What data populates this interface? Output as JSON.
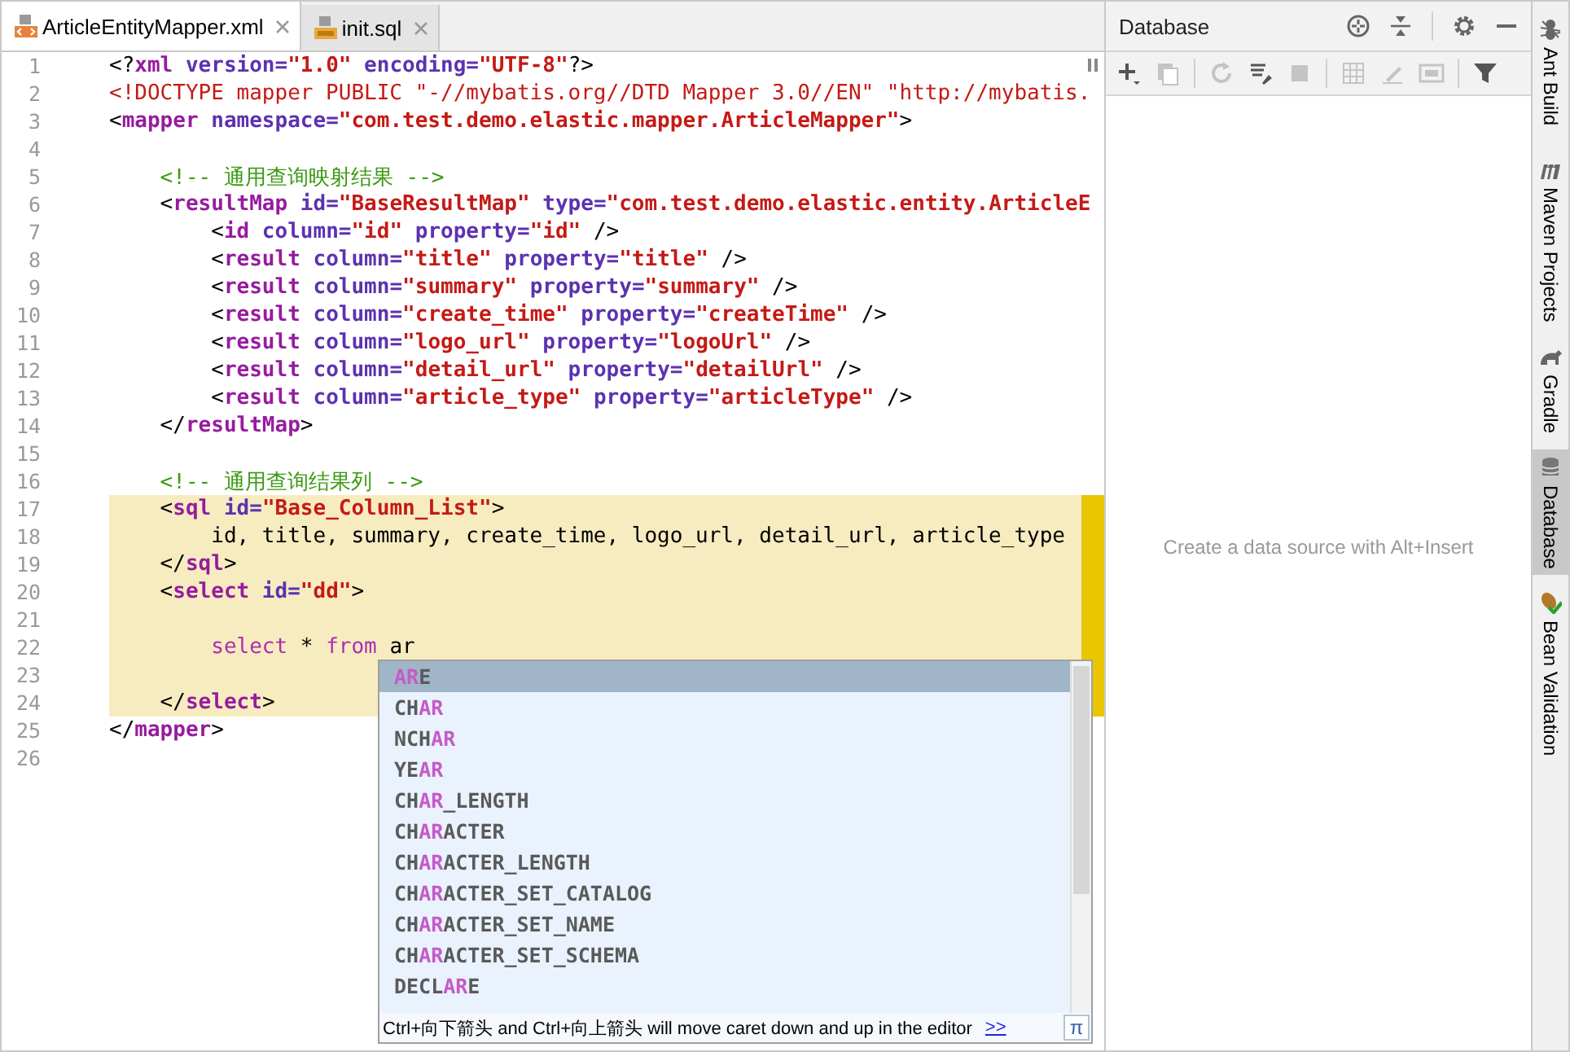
{
  "editor_tabs": [
    {
      "label": "ArticleEntityMapper.xml",
      "kind": "xml",
      "selected": true
    },
    {
      "label": "init.sql",
      "kind": "sql",
      "selected": false
    }
  ],
  "lines": [
    {
      "number": "1",
      "tokens": [
        {
          "kind": "punct",
          "text": "<?"
        },
        {
          "kind": "tag",
          "text": "xml"
        },
        {
          "kind": "attr",
          "text": " version="
        },
        {
          "kind": "value",
          "text": "\"1.0\""
        },
        {
          "kind": "attr",
          "text": " encoding="
        },
        {
          "kind": "value",
          "text": "\"UTF-8\""
        },
        {
          "kind": "punct",
          "text": "?>"
        }
      ]
    },
    {
      "number": "2",
      "tokens": [
        {
          "kind": "doctype",
          "text": "<!DOCTYPE mapper PUBLIC \"-//mybatis.org//DTD Mapper 3.0//EN\" \"http://mybatis."
        }
      ]
    },
    {
      "number": "3",
      "tokens": [
        {
          "kind": "punct",
          "text": "<"
        },
        {
          "kind": "tag",
          "text": "mapper"
        },
        {
          "kind": "attr",
          "text": " namespace="
        },
        {
          "kind": "value",
          "text": "\"com.test.demo.elastic.mapper.ArticleMapper\""
        },
        {
          "kind": "punct",
          "text": ">"
        }
      ]
    },
    {
      "number": "4"
    },
    {
      "number": "5",
      "tokens": [
        {
          "kind": "comment",
          "text": "    <!-- 通用查询映射结果 -->"
        }
      ]
    },
    {
      "number": "6",
      "tokens": [
        {
          "kind": "punct",
          "text": "    <"
        },
        {
          "kind": "tag",
          "text": "resultMap"
        },
        {
          "kind": "attr",
          "text": " id="
        },
        {
          "kind": "value",
          "text": "\"BaseResultMap\""
        },
        {
          "kind": "attr",
          "text": " type="
        },
        {
          "kind": "value",
          "text": "\"com.test.demo.elastic.entity.ArticleE"
        }
      ]
    },
    {
      "number": "7",
      "tokens": [
        {
          "kind": "punct",
          "text": "        <"
        },
        {
          "kind": "tag",
          "text": "id"
        },
        {
          "kind": "attr",
          "text": " column="
        },
        {
          "kind": "value",
          "text": "\"id\""
        },
        {
          "kind": "attr",
          "text": " property="
        },
        {
          "kind": "value",
          "text": "\"id\""
        },
        {
          "kind": "punct",
          "text": " />"
        }
      ]
    },
    {
      "number": "8",
      "tokens": [
        {
          "kind": "punct",
          "text": "        <"
        },
        {
          "kind": "tag",
          "text": "result"
        },
        {
          "kind": "attr",
          "text": " column="
        },
        {
          "kind": "value",
          "text": "\"title\""
        },
        {
          "kind": "attr",
          "text": " property="
        },
        {
          "kind": "value",
          "text": "\"title\""
        },
        {
          "kind": "punct",
          "text": " />"
        }
      ]
    },
    {
      "number": "9",
      "tokens": [
        {
          "kind": "punct",
          "text": "        <"
        },
        {
          "kind": "tag",
          "text": "result"
        },
        {
          "kind": "attr",
          "text": " column="
        },
        {
          "kind": "value",
          "text": "\"summary\""
        },
        {
          "kind": "attr",
          "text": " property="
        },
        {
          "kind": "value",
          "text": "\"summary\""
        },
        {
          "kind": "punct",
          "text": " />"
        }
      ]
    },
    {
      "number": "10",
      "tokens": [
        {
          "kind": "punct",
          "text": "        <"
        },
        {
          "kind": "tag",
          "text": "result"
        },
        {
          "kind": "attr",
          "text": " column="
        },
        {
          "kind": "value",
          "text": "\"create_time\""
        },
        {
          "kind": "attr",
          "text": " property="
        },
        {
          "kind": "value",
          "text": "\"createTime\""
        },
        {
          "kind": "punct",
          "text": " />"
        }
      ]
    },
    {
      "number": "11",
      "tokens": [
        {
          "kind": "punct",
          "text": "        <"
        },
        {
          "kind": "tag",
          "text": "result"
        },
        {
          "kind": "attr",
          "text": " column="
        },
        {
          "kind": "value",
          "text": "\"logo_url\""
        },
        {
          "kind": "attr",
          "text": " property="
        },
        {
          "kind": "value",
          "text": "\"logoUrl\""
        },
        {
          "kind": "punct",
          "text": " />"
        }
      ]
    },
    {
      "number": "12",
      "tokens": [
        {
          "kind": "punct",
          "text": "        <"
        },
        {
          "kind": "tag",
          "text": "result"
        },
        {
          "kind": "attr",
          "text": " column="
        },
        {
          "kind": "value",
          "text": "\"detail_url\""
        },
        {
          "kind": "attr",
          "text": " property="
        },
        {
          "kind": "value",
          "text": "\"detailUrl\""
        },
        {
          "kind": "punct",
          "text": " />"
        }
      ]
    },
    {
      "number": "13",
      "tokens": [
        {
          "kind": "punct",
          "text": "        <"
        },
        {
          "kind": "tag",
          "text": "result"
        },
        {
          "kind": "attr",
          "text": " column="
        },
        {
          "kind": "value",
          "text": "\"article_type\""
        },
        {
          "kind": "attr",
          "text": " property="
        },
        {
          "kind": "value",
          "text": "\"articleType\""
        },
        {
          "kind": "punct",
          "text": " />"
        }
      ]
    },
    {
      "number": "14",
      "tokens": [
        {
          "kind": "punct",
          "text": "    </"
        },
        {
          "kind": "tag",
          "text": "resultMap"
        },
        {
          "kind": "punct",
          "text": ">"
        }
      ]
    },
    {
      "number": "15"
    },
    {
      "number": "16",
      "tokens": [
        {
          "kind": "comment",
          "text": "    <!-- 通用查询结果列 -->"
        }
      ]
    },
    {
      "number": "17",
      "injected": true,
      "tokens": [
        {
          "kind": "punct",
          "text": "    <"
        },
        {
          "kind": "tag",
          "text": "sql"
        },
        {
          "kind": "attr",
          "text": " id="
        },
        {
          "kind": "value",
          "text": "\"Base_Column_List\""
        },
        {
          "kind": "punct",
          "text": ">"
        }
      ]
    },
    {
      "number": "18",
      "injected": true,
      "tokens": [
        {
          "kind": "text",
          "text": "        id, title, summary, create_time, logo_url, detail_url, article_type"
        }
      ]
    },
    {
      "number": "19",
      "injected": true,
      "tokens": [
        {
          "kind": "punct",
          "text": "    </"
        },
        {
          "kind": "tag",
          "text": "sql"
        },
        {
          "kind": "punct",
          "text": ">"
        }
      ]
    },
    {
      "number": "20",
      "injected": true,
      "tokens": [
        {
          "kind": "punct",
          "text": "    <"
        },
        {
          "kind": "tag",
          "text": "select"
        },
        {
          "kind": "attr",
          "text": " id="
        },
        {
          "kind": "value",
          "text": "\"dd\""
        },
        {
          "kind": "punct",
          "text": ">"
        }
      ]
    },
    {
      "number": "21",
      "injected": true
    },
    {
      "number": "22",
      "injected": true,
      "tokens": [
        {
          "kind": "keyword",
          "text": "        select"
        },
        {
          "kind": "text",
          "text": " * "
        },
        {
          "kind": "keyword",
          "text": "from"
        },
        {
          "kind": "text",
          "text": " ar"
        }
      ]
    },
    {
      "number": "23",
      "injected": true
    },
    {
      "number": "24",
      "injected": true,
      "tokens": [
        {
          "kind": "punct",
          "text": "    </"
        },
        {
          "kind": "tag",
          "text": "select"
        },
        {
          "kind": "punct",
          "text": ">"
        }
      ]
    },
    {
      "number": "25",
      "tokens": [
        {
          "kind": "punct",
          "text": "</"
        },
        {
          "kind": "tag",
          "text": "mapper"
        },
        {
          "kind": "punct",
          "text": ">"
        }
      ]
    },
    {
      "number": "26"
    }
  ],
  "completion": {
    "items": [
      {
        "match": "AR",
        "after": "E",
        "selected": true
      },
      {
        "before": "CH",
        "match": "AR",
        "selected": false
      },
      {
        "before": "NCH",
        "match": "AR",
        "selected": false
      },
      {
        "before": "YE",
        "match": "AR",
        "selected": false
      },
      {
        "before": "CH",
        "match": "AR",
        "after": "_LENGTH",
        "selected": false
      },
      {
        "before": "CH",
        "match": "AR",
        "after": "ACTER",
        "selected": false
      },
      {
        "before": "CH",
        "match": "AR",
        "after": "ACTER_LENGTH",
        "selected": false
      },
      {
        "before": "CH",
        "match": "AR",
        "after": "ACTER_SET_CATALOG",
        "selected": false
      },
      {
        "before": "CH",
        "match": "AR",
        "after": "ACTER_SET_NAME",
        "selected": false
      },
      {
        "before": "CH",
        "match": "AR",
        "after": "ACTER_SET_SCHEMA",
        "selected": false
      },
      {
        "before": "DECL",
        "match": "AR",
        "after": "E",
        "selected": false
      }
    ],
    "hint": "Ctrl+向下箭头 and Ctrl+向上箭头 will move caret down and up in the editor",
    "hint_link": ">>",
    "corner_button": "π"
  },
  "database_panel": {
    "title": "Database",
    "toolbar": [
      {
        "kind": "add",
        "disabled": false
      },
      {
        "kind": "copy",
        "disabled": true
      },
      {
        "kind": "sep"
      },
      {
        "kind": "refresh",
        "disabled": true
      },
      {
        "kind": "tools",
        "disabled": false
      },
      {
        "kind": "stop",
        "disabled": true
      },
      {
        "kind": "sep"
      },
      {
        "kind": "table",
        "disabled": true
      },
      {
        "kind": "edit",
        "disabled": true
      },
      {
        "kind": "console",
        "disabled": true
      },
      {
        "kind": "sep"
      },
      {
        "kind": "filter",
        "disabled": false
      }
    ],
    "empty_text": "Create a data source with Alt+Insert"
  },
  "side_tabs": [
    {
      "label": "Ant Build",
      "kind": "ant",
      "selected": false
    },
    {
      "label": "Maven Projects",
      "kind": "maven",
      "selected": false
    },
    {
      "label": "Gradle",
      "kind": "gradle",
      "selected": false
    },
    {
      "label": "Database",
      "kind": "database",
      "selected": true
    },
    {
      "label": "Bean Validation",
      "kind": "bean",
      "selected": false
    }
  ]
}
